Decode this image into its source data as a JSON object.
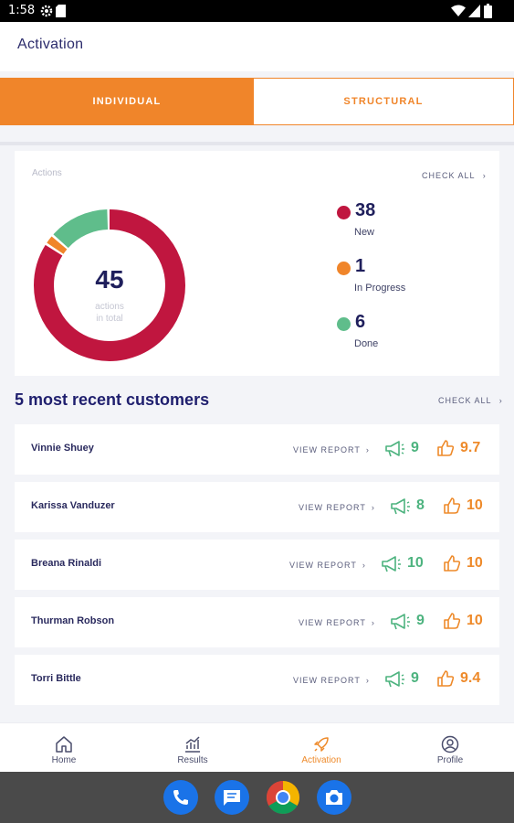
{
  "status_bar": {
    "time": "1:58"
  },
  "app_bar": {
    "title": "Activation"
  },
  "tabs": {
    "individual": "INDIVIDUAL",
    "structural": "STRUCTURAL"
  },
  "actions": {
    "label": "Actions",
    "check_all": "CHECK ALL",
    "total": "45",
    "total_caption_1": "actions",
    "total_caption_2": "in total",
    "breakdown": [
      {
        "value": 38,
        "label": "New",
        "color": "#c0163f"
      },
      {
        "value": 1,
        "label": "In Progress",
        "color": "#f0852a"
      },
      {
        "value": 6,
        "label": "Done",
        "color": "#5fbd8b"
      }
    ]
  },
  "customers": {
    "title": "5 most recent customers",
    "check_all": "CHECK ALL",
    "view_report": "VIEW REPORT",
    "rows": [
      {
        "name": "Vinnie Shuey",
        "megaphone": "9",
        "thumbs": "9.7"
      },
      {
        "name": "Karissa Vanduzer",
        "megaphone": "8",
        "thumbs": "10"
      },
      {
        "name": "Breana Rinaldi",
        "megaphone": "10",
        "thumbs": "10"
      },
      {
        "name": "Thurman Robson",
        "megaphone": "9",
        "thumbs": "10"
      },
      {
        "name": "Torri Bittle",
        "megaphone": "9",
        "thumbs": "9.4"
      }
    ]
  },
  "bottom_nav": {
    "home": "Home",
    "results": "Results",
    "activation": "Activation",
    "profile": "Profile"
  },
  "colors": {
    "accent": "#f0852a",
    "new": "#c0163f",
    "done": "#5fbd8b",
    "navy": "#1f1f5c"
  },
  "dock": [
    "phone-icon",
    "messages-icon",
    "chrome-icon",
    "camera-icon"
  ]
}
